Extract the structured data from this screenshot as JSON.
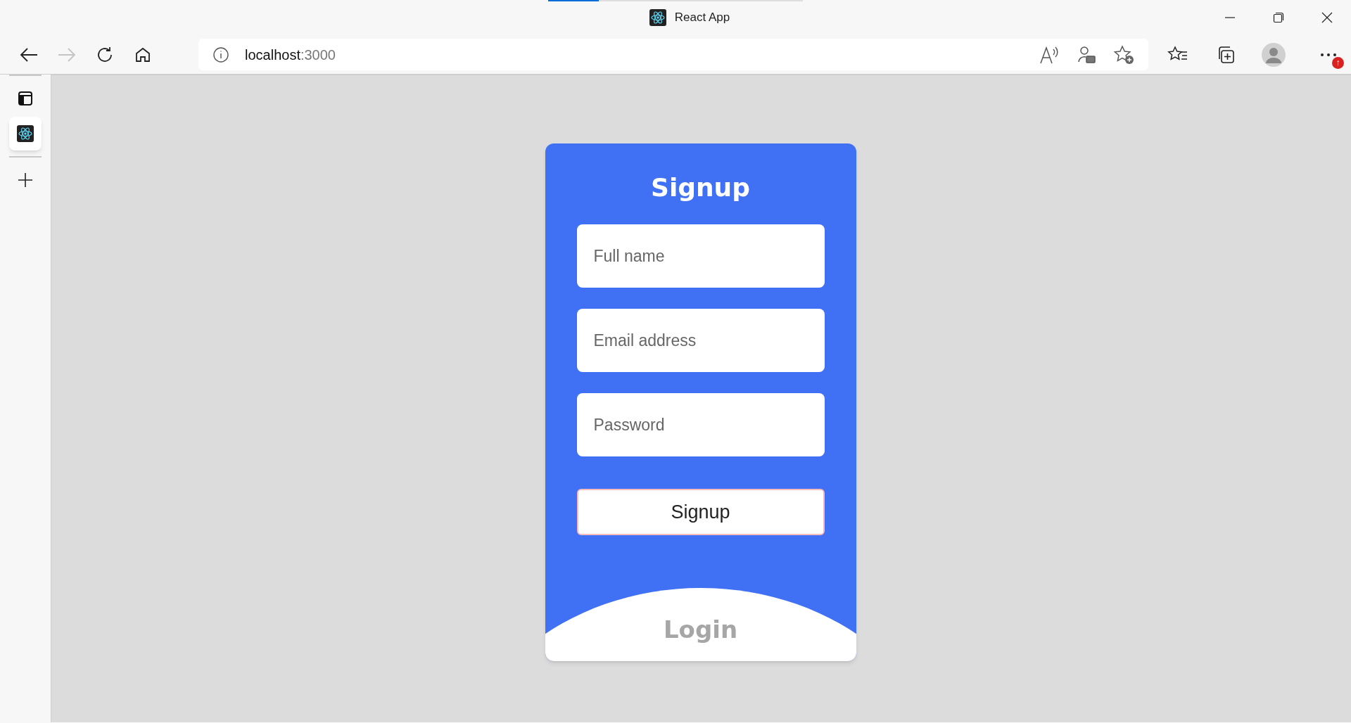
{
  "browser": {
    "tab_title": "React App",
    "address_host": "localhost",
    "address_port": ":3000",
    "notification_badge": "↑"
  },
  "sidebar": {
    "tabs": [
      {
        "selected": true
      }
    ]
  },
  "form": {
    "title": "Signup",
    "fields": [
      {
        "placeholder": "Full name"
      },
      {
        "placeholder": "Email address"
      },
      {
        "placeholder": "Password"
      }
    ],
    "button": "Signup",
    "link": "Login"
  }
}
